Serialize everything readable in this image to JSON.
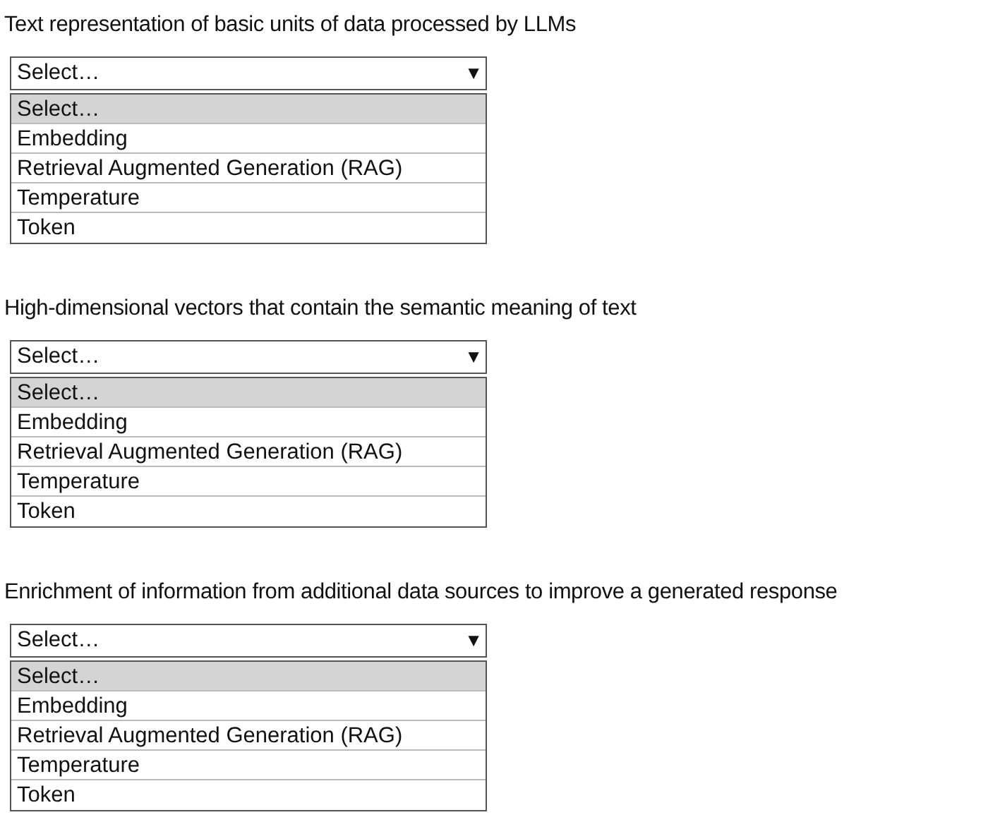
{
  "questions": [
    {
      "prompt": "Text representation of basic units of data processed by LLMs",
      "dropdown": {
        "value": "Select…",
        "arrow": "▼"
      },
      "options": [
        {
          "label": "Select…",
          "selected": true
        },
        {
          "label": "Embedding",
          "selected": false
        },
        {
          "label": "Retrieval Augmented Generation (RAG)",
          "selected": false
        },
        {
          "label": "Temperature",
          "selected": false
        },
        {
          "label": "Token",
          "selected": false
        }
      ]
    },
    {
      "prompt": "High-dimensional vectors that contain the semantic meaning of text",
      "dropdown": {
        "value": "Select…",
        "arrow": "▼"
      },
      "options": [
        {
          "label": "Select…",
          "selected": true
        },
        {
          "label": "Embedding",
          "selected": false
        },
        {
          "label": "Retrieval Augmented Generation (RAG)",
          "selected": false
        },
        {
          "label": "Temperature",
          "selected": false
        },
        {
          "label": "Token",
          "selected": false
        }
      ]
    },
    {
      "prompt": "Enrichment of information from additional data sources to improve a generated response",
      "dropdown": {
        "value": "Select…",
        "arrow": "▼"
      },
      "options": [
        {
          "label": "Select…",
          "selected": true
        },
        {
          "label": "Embedding",
          "selected": false
        },
        {
          "label": "Retrieval Augmented Generation (RAG)",
          "selected": false
        },
        {
          "label": "Temperature",
          "selected": false
        },
        {
          "label": "Token",
          "selected": false
        }
      ]
    }
  ]
}
